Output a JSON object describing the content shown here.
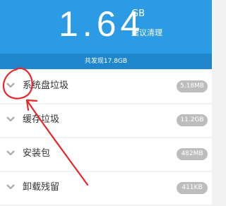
{
  "header": {
    "total_size": "1.64",
    "unit": "GB",
    "suggest_label": "建议清理",
    "found_text": "共发现17.8GB",
    "background_color": "#2b9be5"
  },
  "items": [
    {
      "label": "系统盘垃圾",
      "size": "5.18MB",
      "icon": "chevron-down-icon"
    },
    {
      "label": "缓存垃圾",
      "size": "11.2GB",
      "icon": "chevron-down-icon"
    },
    {
      "label": "安装包",
      "size": "482MB",
      "icon": "chevron-down-icon"
    },
    {
      "label": "卸载残留",
      "size": "411KB",
      "icon": "chevron-down-icon"
    }
  ],
  "annotation": {
    "color": "#e8262a",
    "shape": "circle-and-arrow"
  }
}
